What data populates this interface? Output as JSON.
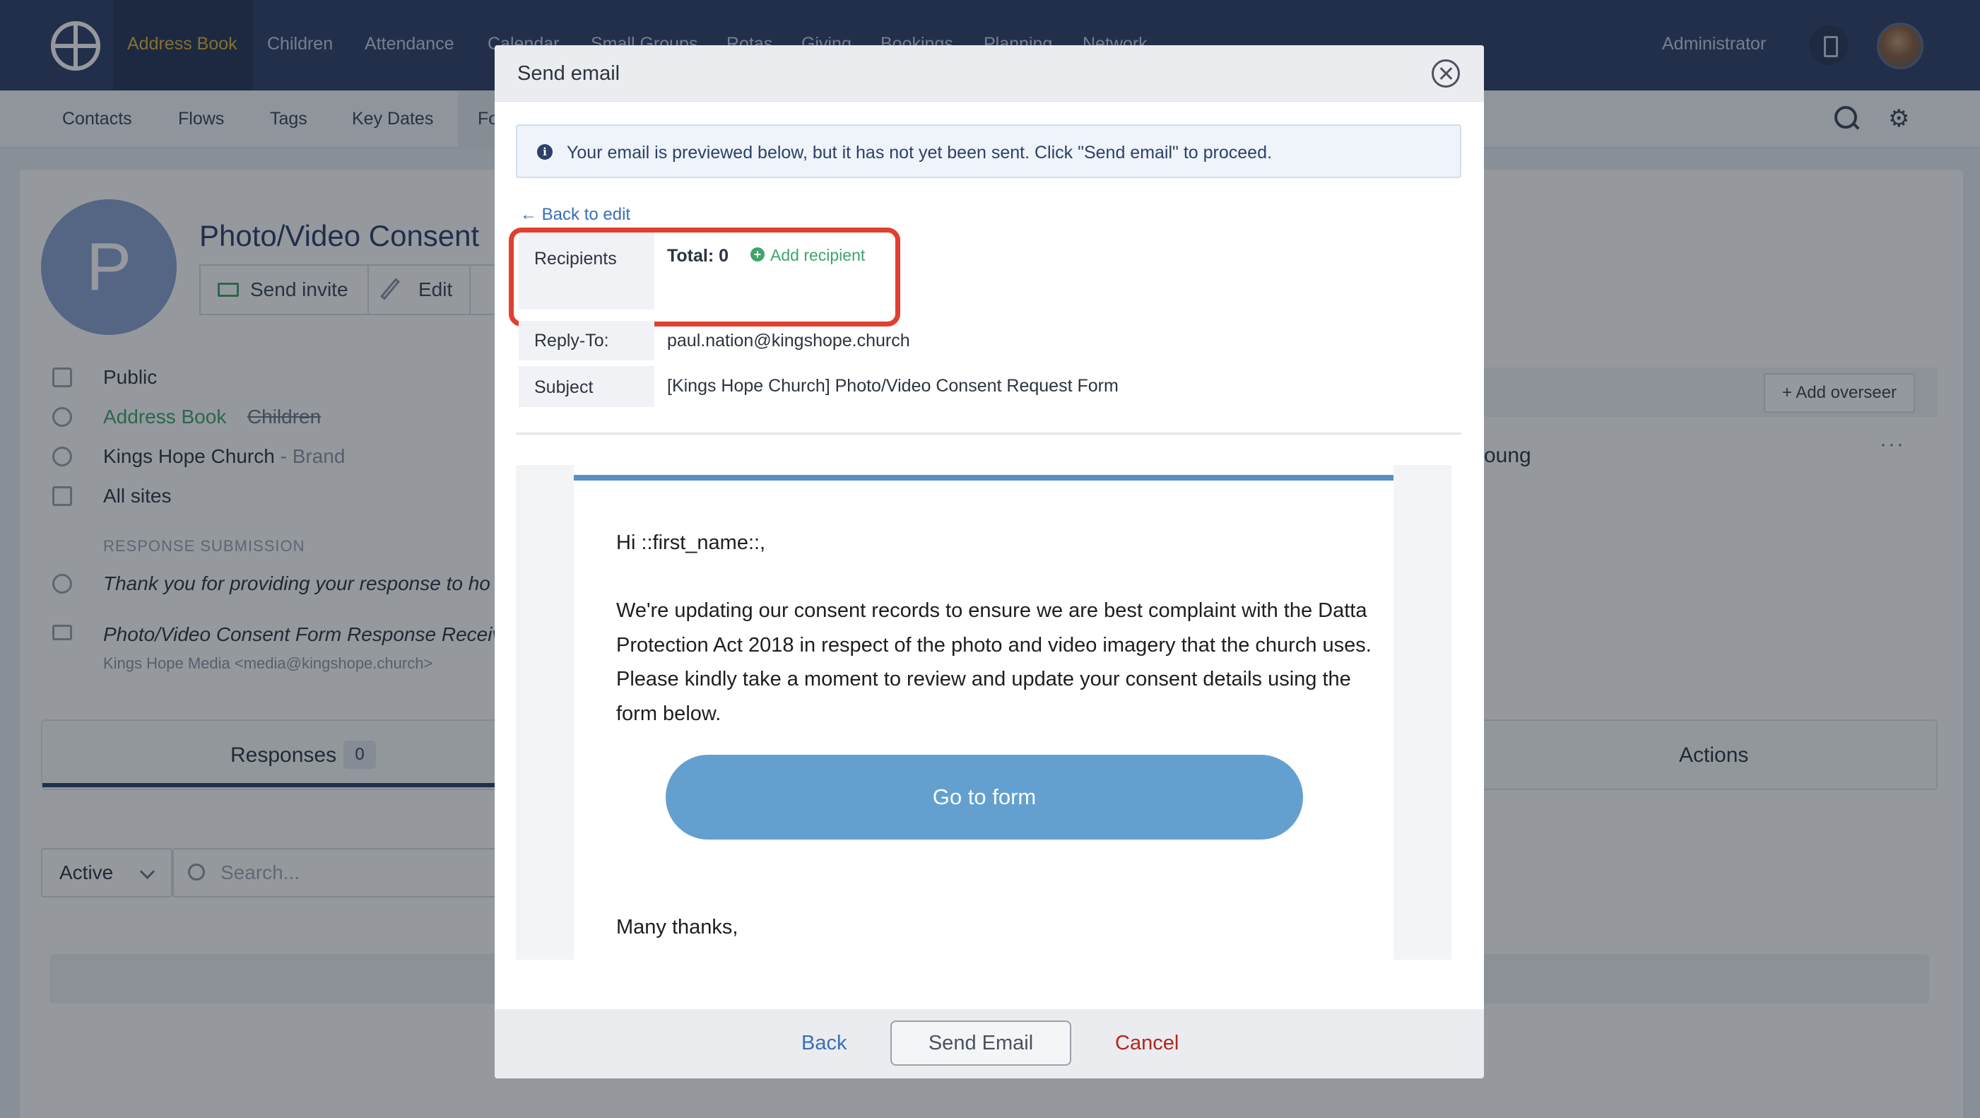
{
  "topnav": {
    "items": [
      "Address Book",
      "Children",
      "Attendance",
      "Calendar",
      "Small Groups",
      "Rotas",
      "Giving",
      "Bookings",
      "Planning",
      "Network"
    ],
    "admin_label": "Administrator",
    "active_color": "#e2b23c",
    "bg_color": "#2e3f68"
  },
  "subnav": {
    "items": [
      "Contacts",
      "Flows",
      "Tags",
      "Key Dates",
      "Fo"
    ]
  },
  "page": {
    "avatar_letter": "P",
    "title": "Photo/Video Consent",
    "send_invite_label": "Send invite",
    "edit_label": "Edit",
    "visibility": "Public",
    "module_1": "Address Book",
    "module_2": "Children",
    "brand_name": "Kings Hope Church",
    "brand_suffix": " - Brand",
    "sites": "All sites",
    "response_label": "RESPONSE SUBMISSION",
    "response_text": "Thank you for providing your response to ho",
    "mail_subject": "Photo/Video Consent Form Response Receive",
    "mail_from": "Kings Hope Media  <media@kingshope.church>",
    "tab_responses": "Responses",
    "tab_responses_count": "0",
    "tab_actions": "Actions",
    "filter_value": "Active",
    "search_placeholder": "Search...",
    "add_overseer": "+ Add overseer",
    "partial_name": "oung",
    "more_dots": "···"
  },
  "modal": {
    "title": "Send email",
    "alert_text": "Your email is previewed below, but it has not yet been sent. Click \"Send email\" to proceed.",
    "back_to_edit": "← Back to edit",
    "recipients_label": "Recipients",
    "total_label": "Total: 0",
    "add_recipient_label": "Add recipient",
    "replyto_label": "Reply-To:",
    "replyto_value": "paul.nation@kingshope.church",
    "subject_label": "Subject",
    "subject_value": "[Kings Hope Church] Photo/Video Consent Request Form",
    "highlight_color": "#e0402e",
    "email": {
      "greeting": "Hi ::first_name::,",
      "body": "We're updating our consent records to ensure we are best complaint with the Datta Protection Act 2018 in respect of the photo and video imagery that the church uses. Please kindly take a moment to review and update your consent details using the form below.",
      "button_label": "Go to form",
      "sign_off": "Many thanks,",
      "accent_color": "#5a8ec9"
    },
    "footer": {
      "back_label": "Back",
      "send_label": "Send Email",
      "cancel_label": "Cancel"
    }
  }
}
